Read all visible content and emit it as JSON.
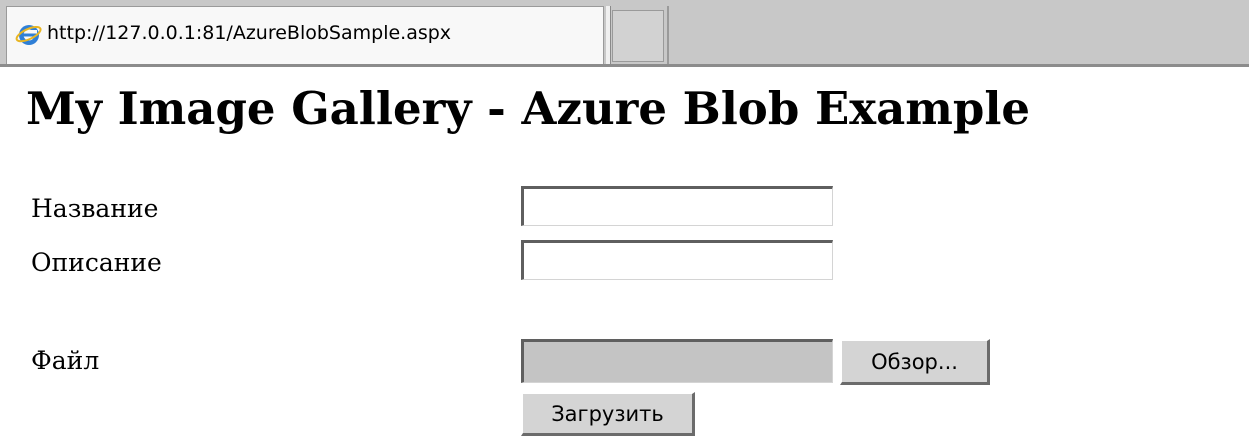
{
  "browser": {
    "tab_url": "http://127.0.0.1:81/AzureBlobSample.aspx",
    "tab_icon": "ie-globe-icon"
  },
  "page": {
    "title": "My Image Gallery - Azure Blob Example"
  },
  "form": {
    "name_label": "Название",
    "name_value": "",
    "description_label": "Описание",
    "description_value": "",
    "file_label": "Файл",
    "browse_label": "Обзор...",
    "upload_label": "Загрузить"
  },
  "colors": {
    "tabbar_background": "#c8c8c8",
    "button_face": "#d4d4d4",
    "file_field_background": "#c4c4c4"
  }
}
